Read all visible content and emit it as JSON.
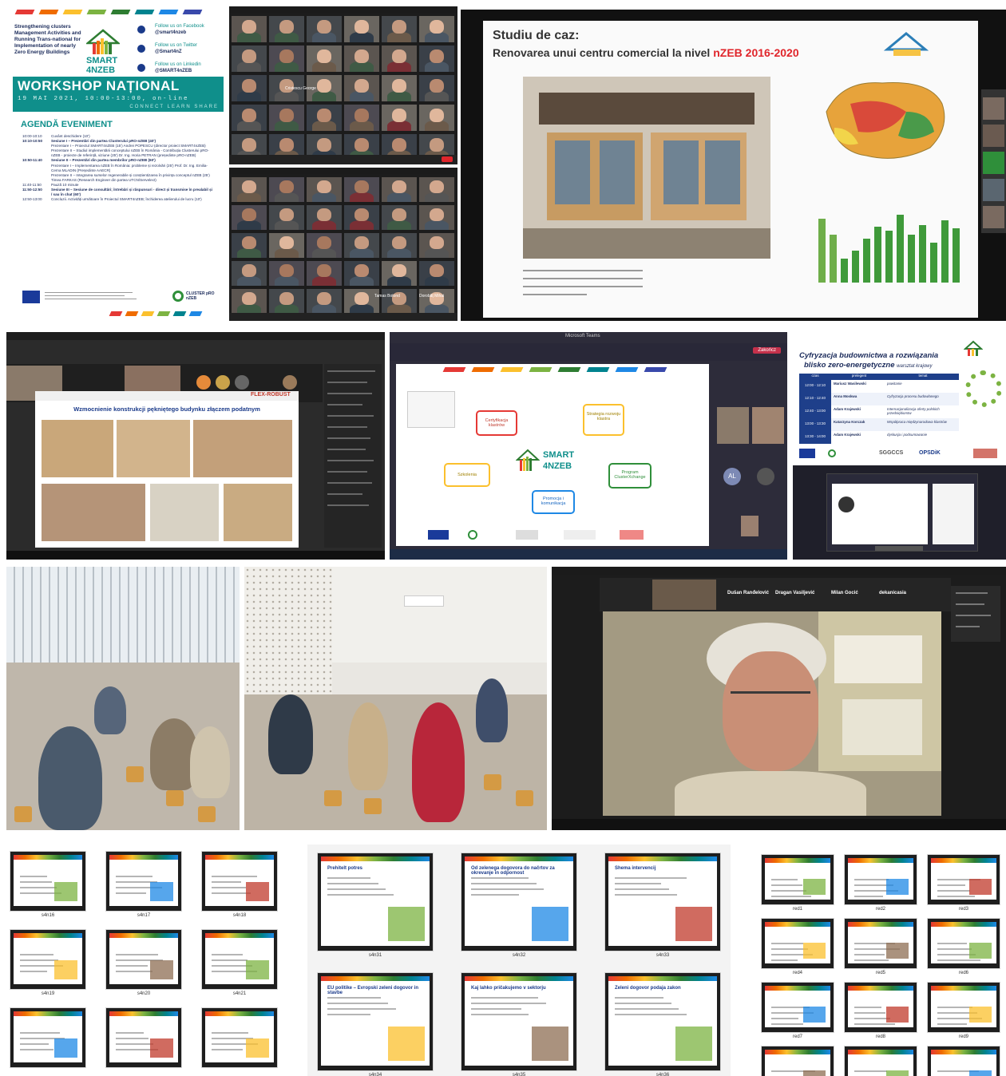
{
  "workshop_poster": {
    "project_desc": "Strengthening clusters Management Activities and Running Trans-national for Implementation of nearly Zero Energy Buildings",
    "logo_line1": "SMART",
    "logo_line2": "4NZEB",
    "social": [
      {
        "label": "Follow us on Facebook",
        "handle": "@smart4nzeb"
      },
      {
        "label": "Follow us on Twitter",
        "handle": "@Smart4nZ"
      },
      {
        "label": "Follow us on Linkedin",
        "handle": "@SMART4nZEB"
      }
    ],
    "title": "WORKSHOP NAȚIONAL",
    "date_line": "19 MAI 2021, 10:00-13:00, on-line",
    "tagline": "CONNECT  LEARN  SHARE",
    "agenda_title": "AGENDĂ EVENIMENT",
    "agenda": [
      {
        "time": "10:00-10:10",
        "text": "Cuvânt deschidere (10')"
      },
      {
        "time": "10:10-10:50",
        "text": "Sesiune I – Prezentări din partea Clusterului pRO-nZEB (40')"
      },
      {
        "time": "",
        "text": "Prezentare I – Proiectul SMART4nZEB (15')   Andrei POPESCU (director proiect SMART4nZEB)"
      },
      {
        "time": "",
        "text": "Prezentare II – Studiul implementării conceptului nZEB în România - Contribuția Clusterului pRO-nZEB - proiecte de referință, viziune (25')   Dr. Ing. Horia PETRAN (președinte pRO-nZEB)"
      },
      {
        "time": "10:50-11:40",
        "text": "Sesiune II – Prezentări din partea membrilor pRO-nZEB (60')"
      },
      {
        "time": "",
        "text": "Prezentare I – Implementarea nZEB în România: probleme și rezolvări (25')   Prof. Dr. Ing. Emilia-Cerna MLADIN (Președinte AAECR)"
      },
      {
        "time": "",
        "text": "Prezentare II – Integrarea surselor regenerabile și conștientizarea în privința conceptul nZEB (25')   Timea FARKAS (Research Engineer din partea UTCN/Servelect)"
      },
      {
        "time": "11:40-11:50",
        "text": "Pauză 10 minute"
      },
      {
        "time": "11:50-12:50",
        "text": "Sesiune III – Sesiune de consultări; întrebări și răspunsuri - direct și transmise în prealabil și / sau în chat (60')"
      },
      {
        "time": "12:50-13:00",
        "text": "Concluzii. Activități următoare în Proiectul SMART4nZEB; închiderea atelierului de lucru (10')"
      }
    ],
    "cluster_label": "CLUSTER pRO nZEB"
  },
  "zoom_grid_names": [
    "Cristescu George",
    "Tamas Botond",
    "Dorobăț Mihai"
  ],
  "case_study": {
    "line1": "Studiu de caz:",
    "line2_prefix": "Renovarea unui centru comercial la nivel ",
    "line2_highlight": "nZEB 2016-2020"
  },
  "polish_slide": {
    "heading": "Wzmocnienie konstrukcji pękniętego budynku złączem podatnym",
    "logo_text": "FLEX-ROBUST"
  },
  "teams_slide": {
    "window_title": "Microsoft Teams",
    "logo_line1": "SMART",
    "logo_line2": "4NZEB",
    "boxes": [
      "Certyfikacja klastrów",
      "Strategia rozwoju klastra",
      "Szkolenia",
      "Promocja i komunikacja",
      "Program ClusterXchange"
    ],
    "leave_label": "Zakończ",
    "avatar": "AL"
  },
  "polish_agenda": {
    "title": "Cyfryzacja budownictwa a rozwiązania",
    "subtitle": "blisko zero-energetyczne",
    "subtitle_tail": "warsztat krajowy",
    "col_time": "czas",
    "col_speaker": "prelegent",
    "col_topic": "temat",
    "rows": [
      {
        "time": "12:00 - 12:10",
        "speaker": "Mariusz Wasilewski",
        "topic": "powitanie"
      },
      {
        "time": "12:10 - 12:40",
        "speaker": "Anna Moskwa",
        "topic": "Cyfryzacja procesu budowlanego"
      },
      {
        "time": "12:40 - 13:00",
        "speaker": "Adam Krajewski",
        "topic": "Internacjonalizacja oferty polskich przedsiębiorstw"
      },
      {
        "time": "13:00 - 13:30",
        "speaker": "Katarzyna Korczak",
        "topic": "Współpraca międzynarodowa klastrów"
      },
      {
        "time": "13:30 - 14:00",
        "speaker": "Adam Krajewski",
        "topic": "dyskusja i podsumowanie"
      }
    ],
    "logos": [
      "SGGCCS",
      "OPSDiK"
    ]
  },
  "webcam": {
    "names": [
      "Dušan Ranđelović",
      "Dragan Vasiljević",
      "Milan Gocić",
      "dekanicasia"
    ]
  },
  "thumbs_a": [
    {
      "cap": "s4n16"
    },
    {
      "cap": "s4n17"
    },
    {
      "cap": "s4n18"
    },
    {
      "cap": "s4n19"
    },
    {
      "cap": "s4n20"
    },
    {
      "cap": "s4n21"
    },
    {
      "cap": ""
    },
    {
      "cap": ""
    },
    {
      "cap": ""
    }
  ],
  "thumbs_b": [
    {
      "cap": "s4n31",
      "title": "Prehitelt potres"
    },
    {
      "cap": "s4n32",
      "title": "Od zelenega dogovora do načrtov za okrevanje in odpornost"
    },
    {
      "cap": "s4n33",
      "title": "Shema intervencij"
    },
    {
      "cap": "s4n34",
      "title": "EU politike – Evropski zeleni dogovor in stavbe"
    },
    {
      "cap": "s4n35",
      "title": "Kaj lahko pričakujemo v sektorju"
    },
    {
      "cap": "s4n36",
      "title": "Zeleni dogovor podaja zakon"
    }
  ],
  "thumbs_c": [
    {
      "cap": "red1"
    },
    {
      "cap": "red2"
    },
    {
      "cap": "red3"
    },
    {
      "cap": "red4"
    },
    {
      "cap": "red5"
    },
    {
      "cap": "red6"
    },
    {
      "cap": "red7"
    },
    {
      "cap": "red8"
    },
    {
      "cap": "red9"
    },
    {
      "cap": ""
    },
    {
      "cap": ""
    },
    {
      "cap": ""
    }
  ],
  "colors": {
    "teal": "#0f8f8b",
    "green": "#2f8f3a",
    "red": "#e0252b",
    "zoom_dark": "#1c1c1c",
    "chair_orange": "#d49a44"
  }
}
